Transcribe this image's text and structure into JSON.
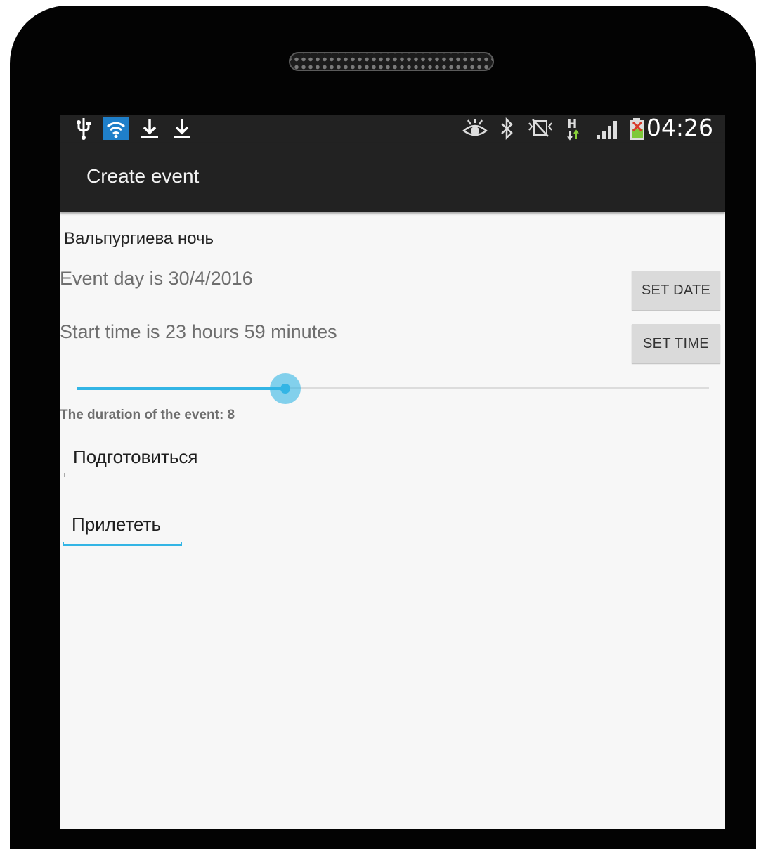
{
  "status_bar": {
    "left_icons": [
      "usb-icon",
      "wifi-icon",
      "download-icon",
      "download-icon"
    ],
    "right_icons": [
      "eye-icon",
      "bluetooth-icon",
      "vibrate-icon",
      "hspa-data-icon",
      "signal-icon",
      "battery-icon"
    ],
    "time": "04:26"
  },
  "action_bar": {
    "title": "Create event"
  },
  "form": {
    "event_name": "Вальпургиева ночь",
    "event_day_text": "Event day is 30/4/2016",
    "set_date_label": "SET DATE",
    "start_time_text": "Start time is 23 hours 59 minutes",
    "set_time_label": "SET TIME",
    "duration_text": "The duration of the event: 8",
    "duration_slider": {
      "value_fraction": 0.33
    },
    "tasks": [
      "Подготовиться",
      "Прилететь"
    ]
  },
  "colors": {
    "accent": "#33b5e5",
    "bar_background": "#222222",
    "screen_background": "#f7f7f7"
  }
}
